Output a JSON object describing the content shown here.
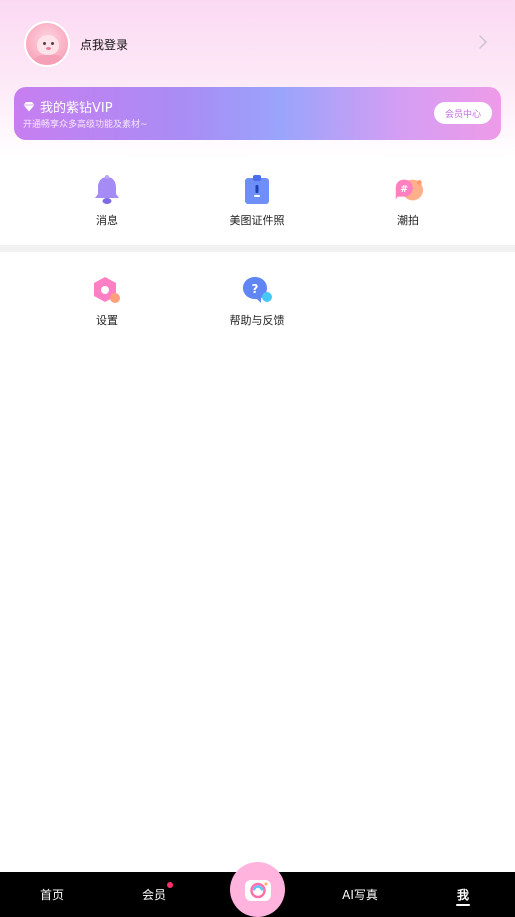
{
  "profile": {
    "login_label": "点我登录"
  },
  "vip": {
    "title": "我的紫钻VIP",
    "subtitle": "开通畅享众多高级功能及素材~",
    "button_label": "会员中心"
  },
  "features_row1": [
    {
      "label": "消息",
      "icon": "bell-icon"
    },
    {
      "label": "美图证件照",
      "icon": "id-photo-icon"
    },
    {
      "label": "潮拍",
      "icon": "hashtag-chat-icon"
    }
  ],
  "features_row2": [
    {
      "label": "设置",
      "icon": "settings-hexagon-icon"
    },
    {
      "label": "帮助与反馈",
      "icon": "help-question-icon"
    }
  ],
  "tabbar": {
    "items": [
      {
        "label": "首页"
      },
      {
        "label": "会员"
      },
      {
        "label": "AI写真"
      },
      {
        "label": "我"
      }
    ],
    "active_index": 3,
    "center_icon": "camera-icon"
  },
  "colors": {
    "vip_gradient_start": "#c77ef0",
    "vip_gradient_end": "#ee9be8",
    "tabbar_bg": "#000000",
    "camera_btn": "#ffb3dd",
    "badge_dot": "#ff2d6b"
  }
}
